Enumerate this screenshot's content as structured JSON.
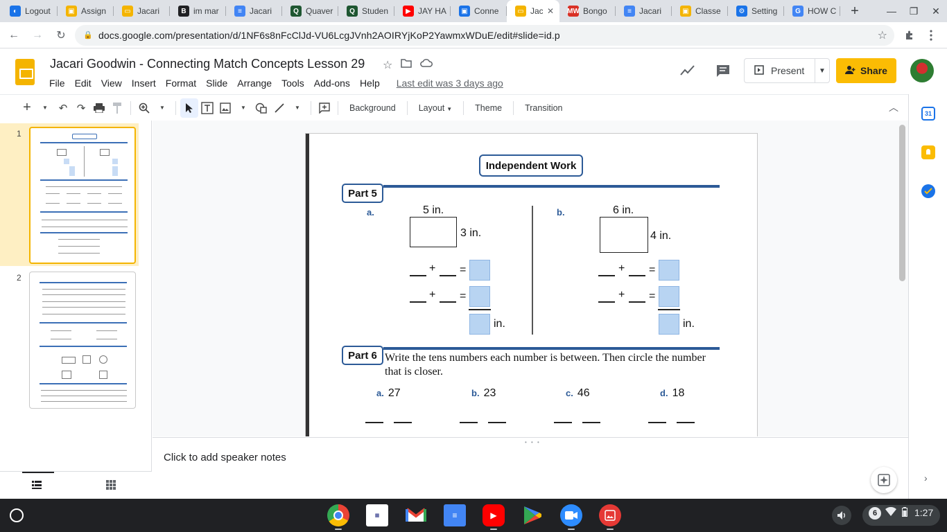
{
  "browser": {
    "tabs": [
      {
        "label": "Logout",
        "color": "#1a73e8",
        "glyph": "◐"
      },
      {
        "label": "Assign",
        "color": "#f4b400",
        "glyph": "▣"
      },
      {
        "label": "Jacari",
        "color": "#f4b400",
        "glyph": "▭"
      },
      {
        "label": "im mar",
        "color": "#202124",
        "glyph": "B"
      },
      {
        "label": "Jacari",
        "color": "#4285f4",
        "glyph": "≡"
      },
      {
        "label": "Quaver",
        "color": "#1e5631",
        "glyph": "Q"
      },
      {
        "label": "Studen",
        "color": "#1e5631",
        "glyph": "Q"
      },
      {
        "label": "JAY HA",
        "color": "#ff0000",
        "glyph": "▶"
      },
      {
        "label": "Conne",
        "color": "#1a73e8",
        "glyph": "▣"
      },
      {
        "label": "Jac",
        "color": "#f4b400",
        "glyph": "▭",
        "active": true
      },
      {
        "label": "Bongo",
        "color": "#d93025",
        "glyph": "MW"
      },
      {
        "label": "Jacari",
        "color": "#4285f4",
        "glyph": "≡"
      },
      {
        "label": "Classe",
        "color": "#f4b400",
        "glyph": "▣"
      },
      {
        "label": "Setting",
        "color": "#1a73e8",
        "glyph": "⚙"
      },
      {
        "label": "HOW C",
        "color": "#4285f4",
        "glyph": "G"
      }
    ],
    "url": "docs.google.com/presentation/d/1NF6s8nFcClJd-VU6LcgJVnh2AOIRYjKoP2YawmxWDuE/edit#slide=id.p"
  },
  "doc": {
    "title": "Jacari Goodwin - Connecting Match Concepts Lesson 29",
    "menu": [
      "File",
      "Edit",
      "View",
      "Insert",
      "Format",
      "Slide",
      "Arrange",
      "Tools",
      "Add-ons",
      "Help"
    ],
    "last_edit": "Last edit was 3 days ago",
    "present_label": "Present",
    "share_label": "Share"
  },
  "toolbar": {
    "background": "Background",
    "layout": "Layout",
    "theme": "Theme",
    "transition": "Transition"
  },
  "filmstrip": {
    "slides": [
      {
        "num": "1"
      },
      {
        "num": "2"
      }
    ]
  },
  "slide": {
    "heading": "Independent Work",
    "part5": {
      "title": "Part 5",
      "a_label": "a.",
      "b_label": "b.",
      "a_width": "5 in.",
      "a_height": "3 in.",
      "b_width": "6 in.",
      "b_height": "4 in.",
      "unit": "in.",
      "plus": "+",
      "equals": "="
    },
    "part6": {
      "title": "Part 6",
      "instructions": "Write the tens numbers each number is between. Then circle the number that is closer.",
      "items": [
        {
          "label": "a.",
          "value": "27"
        },
        {
          "label": "b.",
          "value": "23"
        },
        {
          "label": "c.",
          "value": "46"
        },
        {
          "label": "d.",
          "value": "18"
        }
      ]
    }
  },
  "notes": {
    "placeholder": "Click to add speaker notes"
  },
  "taskbar": {
    "notif_count": "6",
    "time": "1:27"
  }
}
